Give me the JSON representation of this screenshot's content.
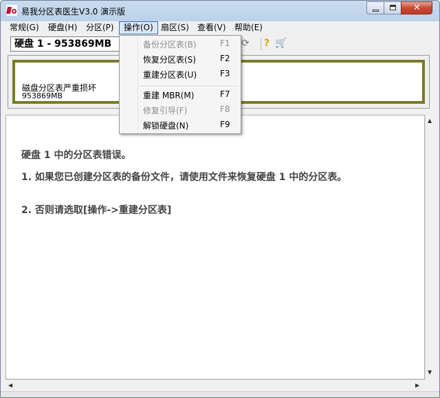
{
  "window": {
    "title": "易我分区表医生V3.0 演示版"
  },
  "menubar": {
    "items": [
      {
        "label": "常规(G)"
      },
      {
        "label": "硬盘(H)"
      },
      {
        "label": "分区(P)"
      },
      {
        "label": "操作(O)"
      },
      {
        "label": "扇区(S)"
      },
      {
        "label": "查看(V)"
      },
      {
        "label": "帮助(E)"
      }
    ],
    "active_index": 3
  },
  "toolbar": {
    "disk_selector_value": "硬盘 1 - 953869MB",
    "icons": [
      "refresh-icon",
      "help-icon",
      "cart-icon"
    ]
  },
  "disk_map": {
    "status": "磁盘分区表严重损坏",
    "size": "953869MB"
  },
  "operations_menu": {
    "items": [
      {
        "label": "备份分区表(B)",
        "shortcut": "F1",
        "enabled": false
      },
      {
        "label": "恢复分区表(S)",
        "shortcut": "F2",
        "enabled": true
      },
      {
        "label": "重建分区表(U)",
        "shortcut": "F3",
        "enabled": true
      },
      {
        "label": "重建 MBR(M)",
        "shortcut": "F7",
        "enabled": true
      },
      {
        "label": "修复引导(F)",
        "shortcut": "F8",
        "enabled": false
      },
      {
        "label": "解锁硬盘(N)",
        "shortcut": "F9",
        "enabled": true
      }
    ]
  },
  "message": {
    "line1": "硬盘 1 中的分区表错误。",
    "line2": "1. 如果您已创建分区表的备份文件，请使用文件来恢复硬盘 1 中的分区表。",
    "line3": "2. 否则请选取[操作->重建分区表]"
  },
  "colors": {
    "disk_bar_border": "#7a7a26",
    "close_button": "#c0392b",
    "menu_highlight": "#dbe8f7"
  }
}
